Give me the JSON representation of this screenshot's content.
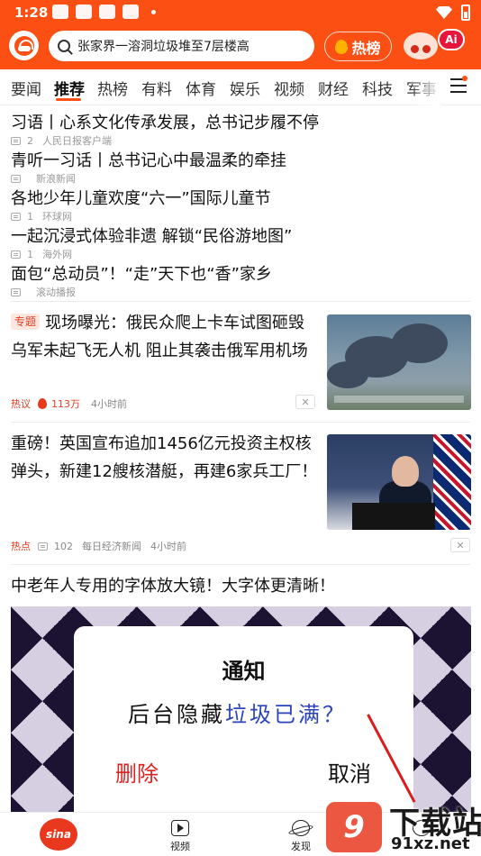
{
  "status_bar": {
    "time": "1:28"
  },
  "search": {
    "text": "张家界一溶洞垃圾堆至7层楼高"
  },
  "header": {
    "hot_label": "热榜",
    "ai_label": "Ai"
  },
  "tabs": [
    {
      "label": "要闻"
    },
    {
      "label": "推荐"
    },
    {
      "label": "热榜"
    },
    {
      "label": "有料"
    },
    {
      "label": "体育"
    },
    {
      "label": "娱乐"
    },
    {
      "label": "视频"
    },
    {
      "label": "财经"
    },
    {
      "label": "科技"
    },
    {
      "label": "军事"
    }
  ],
  "headlines": [
    {
      "title": "习语丨心系文化传承发展，总书记步履不停",
      "comments": "2",
      "source": "人民日报客户端"
    },
    {
      "title": "青听一习话丨总书记心中最温柔的牵挂",
      "comments": "",
      "source": "新浪新闻"
    },
    {
      "title": "各地少年儿童欢度“六一”国际儿童节",
      "comments": "1",
      "source": "环球网"
    },
    {
      "title": "一起沉浸式体验非遗 解锁“民俗游地图”",
      "comments": "1",
      "source": "海外网"
    },
    {
      "title": "面包“总动员”！“走”天下也“香”家乡",
      "comments": "",
      "source": "滚动播报"
    }
  ],
  "articles": [
    {
      "badge": "专题",
      "title": "现场曝光：俄民众爬上卡车试图砸毁乌军未起飞无人机 阻止其袭击俄军用机场",
      "tag": "热议",
      "count": "113万",
      "time": "4小时前"
    },
    {
      "title": "重磅！英国宣布追加1456亿元投资主权核弹头，新建12艘核潜艇，再建6家兵工厂！",
      "tag": "热点",
      "comments": "102",
      "source": "每日经济新闻",
      "time": "4小时前"
    }
  ],
  "ad": {
    "title": "中老年人专用的字体放大镜！大字体更清晰！",
    "dialog_title": "通知",
    "dialog_msg_prefix": "后台隐藏",
    "dialog_msg_highlight": "垃圾已满？",
    "delete_label": "删除",
    "cancel_label": "取消"
  },
  "bottom_nav": {
    "home": "sina",
    "video": "视频",
    "discover": "发现"
  },
  "watermark": {
    "big": "下载站",
    "logo": "9",
    "url": "91xz.net"
  },
  "colors": {
    "brand": "#fb4f14",
    "hot": "#e8391e",
    "highlight_blue": "#2a43b8"
  }
}
